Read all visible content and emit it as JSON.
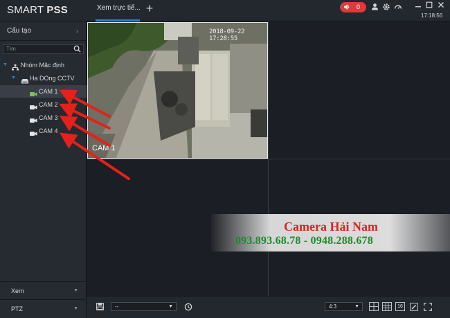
{
  "app": {
    "logo_prefix": "SMART ",
    "logo_bold": "PSS",
    "tab_title": "Xem trực tiế...",
    "add_tab": "+",
    "alarm_count": "0",
    "clock": "17:18:56",
    "accent_color": "#2f7fd0",
    "alarm_color": "#e0393a"
  },
  "topbar_icons": [
    "speaker-icon",
    "user-icon",
    "gear-icon",
    "gauge-icon",
    "minimize-icon",
    "maximize-icon",
    "close-icon"
  ],
  "sidebar": {
    "header": "Cấu tạo",
    "search_placeholder": "Tìm",
    "tree": {
      "group": "Nhóm Mặc định",
      "device": "Ha DOng CCTV",
      "cameras": [
        "CAM 1",
        "CAM 2",
        "CAM 3",
        "CAM 4"
      ]
    },
    "bottom": [
      {
        "label": "Xem"
      },
      {
        "label": "PTZ"
      }
    ]
  },
  "view": {
    "timestamp": "2018-09-22 17:28:55",
    "cam_label": "CAM 1"
  },
  "watermark": {
    "title": "Camera Hải Nam",
    "phones": "093.893.68.78 - 0948.288.678"
  },
  "toolbar": {
    "stream_select": "--",
    "aspect_ratio": "4:3",
    "layout_16": "16"
  }
}
